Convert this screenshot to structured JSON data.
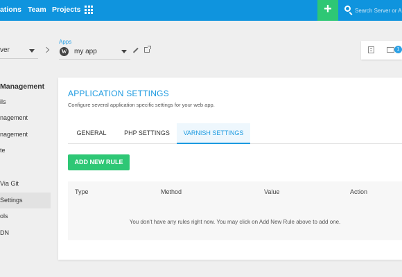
{
  "topbar": {
    "nav": [
      "ations",
      "Team",
      "Projects"
    ],
    "add_label": "+",
    "search_placeholder": "Search Server or Ap"
  },
  "selector": {
    "server_value": "ver",
    "apps_label": "Apps",
    "app_value": "my app",
    "notification_count": "1"
  },
  "sidebar": {
    "heading": "Management",
    "items": [
      "ils",
      "nagement",
      "nagement",
      "te",
      "Via Git",
      "Settings",
      "ols",
      "DN"
    ]
  },
  "card": {
    "title": "APPLICATION SETTINGS",
    "subtitle": "Configure several application specific settings for your web app.",
    "tabs": [
      "GENERAL",
      "PHP SETTINGS",
      "VARNISH SETTINGS"
    ],
    "active_tab": "VARNISH SETTINGS",
    "add_button": "ADD NEW RULE",
    "table": {
      "headers": [
        "Type",
        "Method",
        "Value",
        "Action"
      ],
      "empty_message": "You don't have any rules right now. You may click on Add New Rule above to add one."
    }
  },
  "colors": {
    "topbar": "#0f94de",
    "accent": "#1b9ae0",
    "success": "#2ec775"
  }
}
